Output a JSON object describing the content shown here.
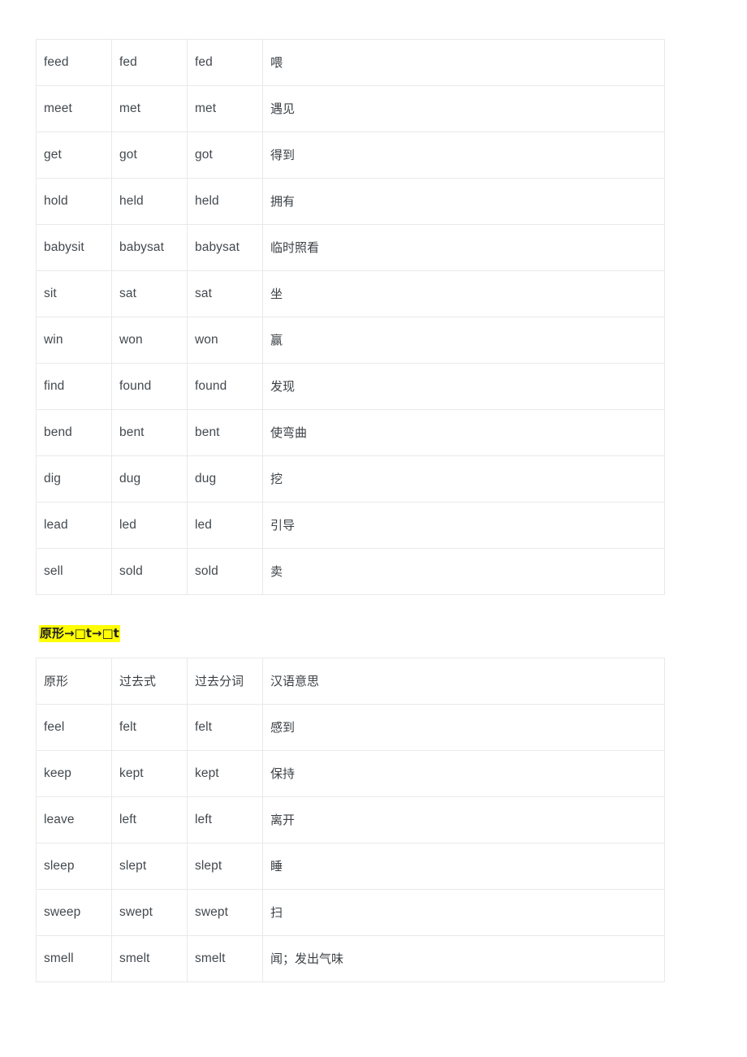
{
  "page": {
    "background_color": "#ffffff",
    "highlight_color": "#ffff00",
    "text_color": "#40464d",
    "border_color": "#e9e9e9"
  },
  "tables": [
    {
      "id": "table-irregular-verbs-same-past-participle",
      "has_header": false,
      "columns": [
        "原形",
        "过去式",
        "过去分词",
        "汉语意思"
      ],
      "rows": [
        {
          "base": "feed",
          "past": "fed",
          "participle": "fed",
          "meaning": "喂"
        },
        {
          "base": "meet",
          "past": "met",
          "participle": "met",
          "meaning": "遇见"
        },
        {
          "base": "get",
          "past": "got",
          "participle": "got",
          "meaning": "得到"
        },
        {
          "base": "hold",
          "past": "held",
          "participle": "held",
          "meaning": "拥有"
        },
        {
          "base": "babysit",
          "past": "babysat",
          "participle": "babysat",
          "meaning": "临时照看"
        },
        {
          "base": "sit",
          "past": "sat",
          "participle": "sat",
          "meaning": "坐"
        },
        {
          "base": "win",
          "past": "won",
          "participle": "won",
          "meaning": "赢"
        },
        {
          "base": "find",
          "past": "found",
          "participle": "found",
          "meaning": "发现"
        },
        {
          "base": "bend",
          "past": "bent",
          "participle": "bent",
          "meaning": "使弯曲"
        },
        {
          "base": "dig",
          "past": "dug",
          "participle": "dug",
          "meaning": "挖"
        },
        {
          "base": "lead",
          "past": "led",
          "participle": "led",
          "meaning": "引导"
        },
        {
          "base": "sell",
          "past": "sold",
          "participle": "sold",
          "meaning": "卖"
        }
      ]
    },
    {
      "id": "table-pattern-t-ending",
      "has_header": true,
      "header": {
        "base": "原形",
        "past": "过去式",
        "participle": "过去分词",
        "meaning": "汉语意思"
      },
      "rows": [
        {
          "base": "feel",
          "past": "felt",
          "participle": "felt",
          "meaning": "感到"
        },
        {
          "base": "keep",
          "past": "kept",
          "participle": "kept",
          "meaning": "保持"
        },
        {
          "base": "leave",
          "past": "left",
          "participle": "left",
          "meaning": "离开"
        },
        {
          "base": "sleep",
          "past": "slept",
          "participle": "slept",
          "meaning": "睡"
        },
        {
          "base": "sweep",
          "past": "swept",
          "participle": "swept",
          "meaning": "扫"
        },
        {
          "base": "smell",
          "past": "smelt",
          "participle": "smelt",
          "meaning": "闻；发出气味"
        }
      ]
    }
  ],
  "section_heading": {
    "text": "原形→□t→□t",
    "highlighted": true
  }
}
